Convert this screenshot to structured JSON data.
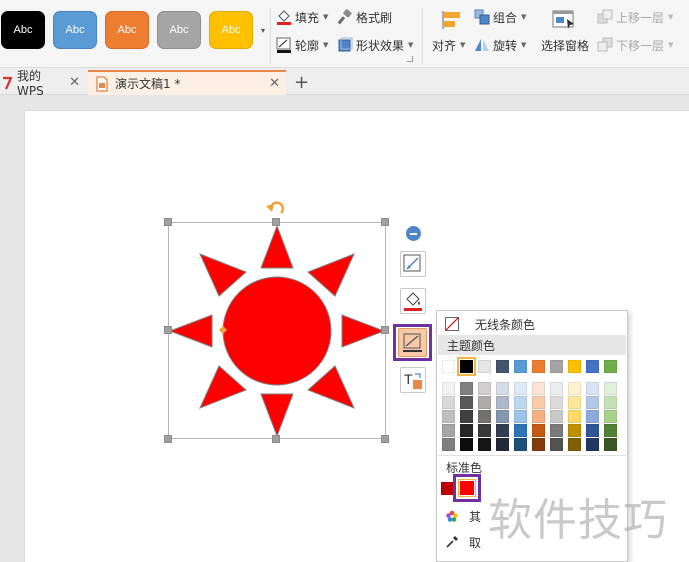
{
  "ribbon": {
    "style_presets": [
      {
        "label": "Abc",
        "bg": "#000000",
        "border": "#000000"
      },
      {
        "label": "Abc",
        "bg": "#5b9bd5",
        "border": "#4a86bd"
      },
      {
        "label": "Abc",
        "bg": "#ed7d31",
        "border": "#d86a20"
      },
      {
        "label": "Abc",
        "bg": "#a5a5a5",
        "border": "#8f8f8f"
      },
      {
        "label": "Abc",
        "bg": "#ffc000",
        "border": "#e5ac00"
      }
    ],
    "fill_label": "填充",
    "format_painter_label": "格式刷",
    "outline_label": "轮廓",
    "shape_effects_label": "形状效果",
    "align_label": "对齐",
    "group_label": "组合",
    "rotate_label": "旋转",
    "selection_pane_label": "选择窗格",
    "bring_forward_label": "上移一层",
    "send_backward_label": "下移一层"
  },
  "tabs": [
    {
      "label": "我的WPS",
      "icon": "wps-logo-icon"
    },
    {
      "label": "演示文稿1 *",
      "icon": "presentation-doc-icon"
    }
  ],
  "new_tab_symbol": "+",
  "slide": {
    "shape": "sun",
    "shape_fill": "#ff0000",
    "shape_outline": "#7f7f7f"
  },
  "floating_toolbar": {
    "buttons": [
      "collapse-icon",
      "shape-style-icon",
      "fill-bucket-icon",
      "outline-pen-icon",
      "text-box-icon"
    ]
  },
  "outline_dropdown": {
    "no_line_label": "无线条颜色",
    "theme_colors_label": "主题颜色",
    "theme_row": [
      "#ffffff",
      "#000000",
      "#e7e6e6",
      "#44546a",
      "#5b9bd5",
      "#ed7d31",
      "#a5a5a5",
      "#ffc000",
      "#4472c4",
      "#70ad47"
    ],
    "theme_shades": [
      [
        "#f2f2f2",
        "#808080",
        "#d0cece",
        "#d6dce5",
        "#deebf7",
        "#fbe5d6",
        "#ededed",
        "#fff2cc",
        "#dae3f3",
        "#e2f0d9"
      ],
      [
        "#d9d9d9",
        "#595959",
        "#afabab",
        "#adb9ca",
        "#bdd7ee",
        "#f8cbad",
        "#dbdbdb",
        "#ffe699",
        "#b4c7e7",
        "#c5e0b4"
      ],
      [
        "#bfbfbf",
        "#404040",
        "#767171",
        "#8497b0",
        "#9dc3e6",
        "#f4b183",
        "#c9c9c9",
        "#ffd966",
        "#8faadc",
        "#a9d18e"
      ],
      [
        "#a6a6a6",
        "#262626",
        "#3a3838",
        "#333f50",
        "#2e75b6",
        "#c55a11",
        "#7b7b7b",
        "#bf9000",
        "#2f5597",
        "#538135"
      ],
      [
        "#7f7f7f",
        "#0d0d0d",
        "#171616",
        "#222a35",
        "#1f4e79",
        "#843c0c",
        "#525252",
        "#7f6000",
        "#203864",
        "#385723"
      ]
    ],
    "standard_colors_label": "标准色",
    "standard_colors": [
      "#c00000",
      "#ff0000"
    ],
    "more_colors_label": "其",
    "eyedropper_label": "取"
  },
  "watermark": "软件技巧",
  "colors": {
    "highlight_box": "#7030a0",
    "selection_handle": "#a0a0a0",
    "rotate_handle": "#f0a030",
    "tab_active_accent": "#e8894b"
  }
}
